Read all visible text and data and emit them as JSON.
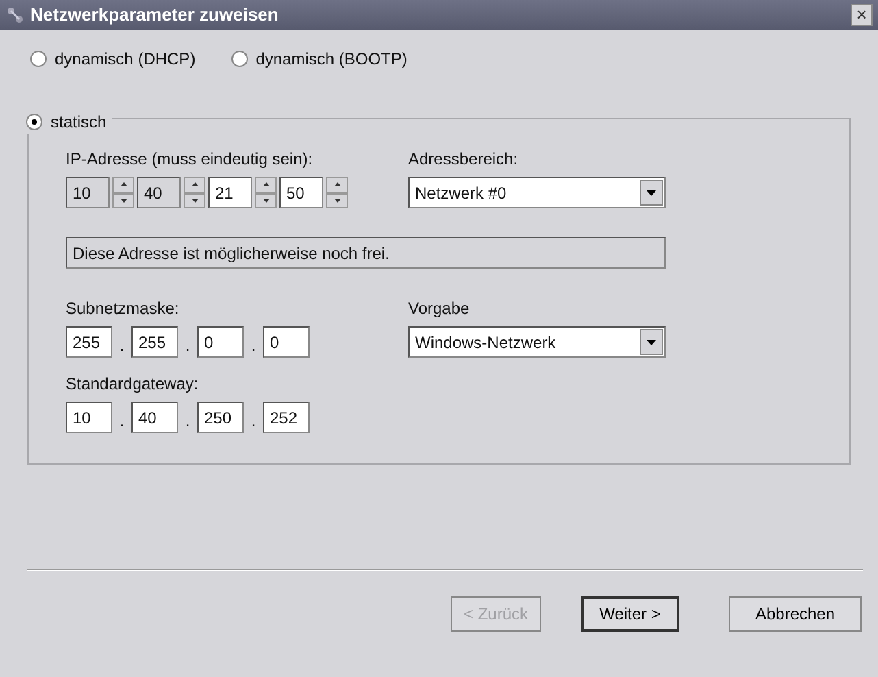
{
  "window": {
    "title": "Netzwerkparameter zuweisen",
    "close": "×"
  },
  "modes": [
    {
      "label": "dynamisch (DHCP)",
      "selected": false
    },
    {
      "label": "dynamisch (BOOTP)",
      "selected": false
    },
    {
      "label": "statisch",
      "selected": true
    }
  ],
  "ip": {
    "label": "IP-Adresse (muss eindeutig sein):",
    "octets": [
      {
        "value": "10",
        "disabled": true
      },
      {
        "value": "40",
        "disabled": true
      },
      {
        "value": "21",
        "disabled": false
      },
      {
        "value": "50",
        "disabled": false
      }
    ]
  },
  "range": {
    "label": "Adressbereich:",
    "value": "Netzwerk #0"
  },
  "status": "Diese Adresse ist möglicherweise noch frei.",
  "subnet": {
    "label": "Subnetzmaske:",
    "parts": [
      {
        "kind": "octet",
        "text": "255"
      },
      {
        "kind": "dot",
        "text": "."
      },
      {
        "kind": "octet",
        "text": "255"
      },
      {
        "kind": "dot",
        "text": "."
      },
      {
        "kind": "octet",
        "text": "0"
      },
      {
        "kind": "dot",
        "text": "."
      },
      {
        "kind": "octet",
        "text": "0"
      }
    ]
  },
  "preset": {
    "label": "Vorgabe",
    "value": "Windows-Netzwerk"
  },
  "gateway": {
    "label": "Standardgateway:",
    "parts": [
      {
        "kind": "octet",
        "text": "10"
      },
      {
        "kind": "dot",
        "text": "."
      },
      {
        "kind": "octet",
        "text": "40"
      },
      {
        "kind": "dot",
        "text": "."
      },
      {
        "kind": "octet",
        "text": "250"
      },
      {
        "kind": "dot",
        "text": "."
      },
      {
        "kind": "octet",
        "text": "252"
      }
    ]
  },
  "buttons": [
    {
      "label": "< Zurück",
      "disabled": true,
      "default": false
    },
    {
      "label": "Weiter >",
      "disabled": false,
      "default": true
    },
    {
      "label": "Abbrechen",
      "disabled": false,
      "default": false
    }
  ]
}
